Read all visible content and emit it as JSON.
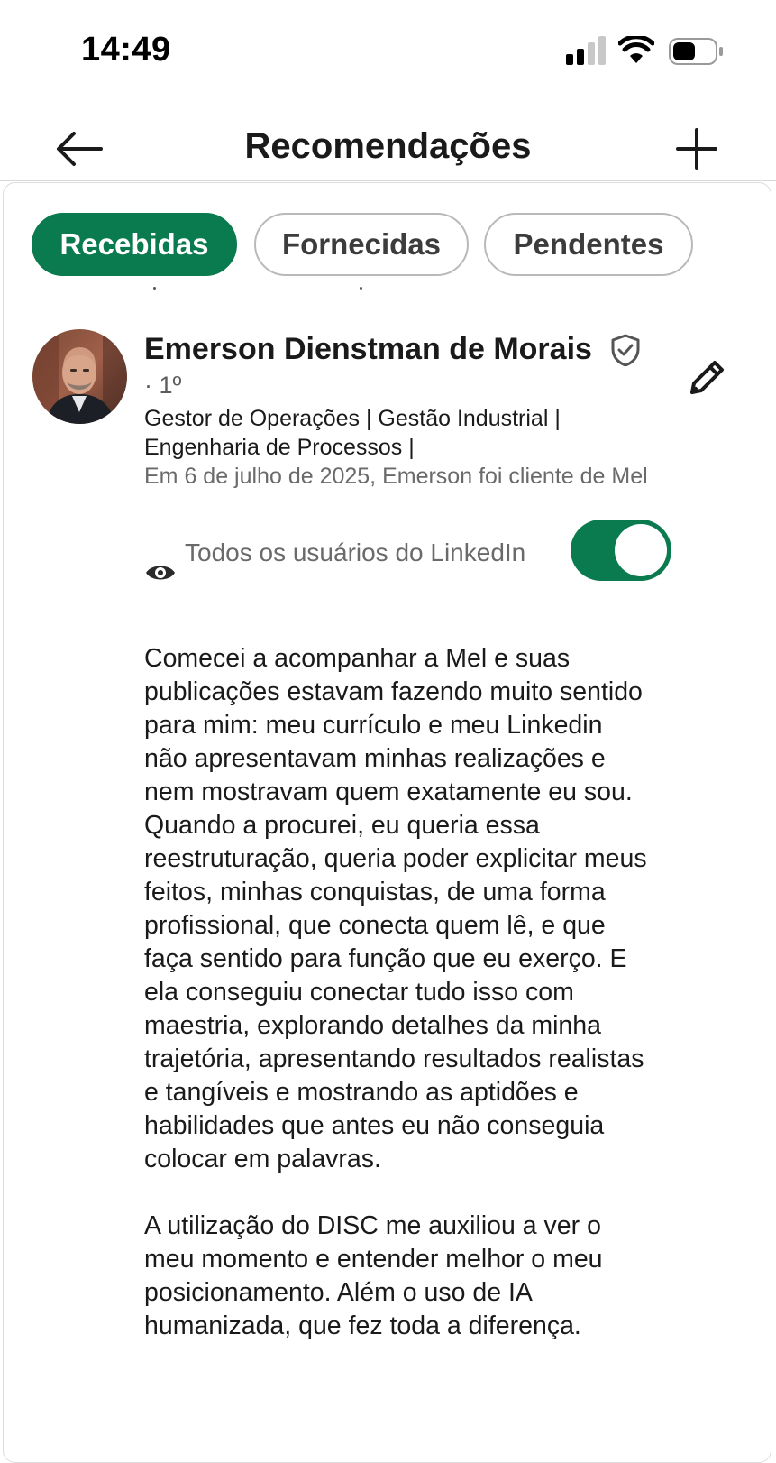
{
  "status_bar": {
    "time": "14:49",
    "icons": [
      "signal-icon",
      "wifi-icon",
      "battery-icon"
    ]
  },
  "nav": {
    "title": "Recomendações",
    "back_icon": "arrow-left-icon",
    "add_icon": "plus-icon"
  },
  "tabs": [
    {
      "label": "Recebidas",
      "active": true
    },
    {
      "label": "Fornecidas",
      "active": false
    },
    {
      "label": "Pendentes",
      "active": false
    }
  ],
  "recommendation": {
    "name": "Emerson Dienstman de Morais",
    "verified_icon": "verified-shield-icon",
    "degree": "· 1º",
    "headline_line1": "Gestor de Operações | Gestão Industrial |",
    "headline_line2": "Engenharia de Processos |",
    "relation": "Em 6 de julho de 2025, Emerson foi cliente de Mel",
    "visibility": "Todos os usuários do LinkedIn",
    "visibility_enabled": true,
    "edit_icon": "pencil-icon",
    "paragraph1": "Comecei a acompanhar a Mel e suas publicações estavam fazendo muito sentido para mim: meu currículo e meu Linkedin não apresentavam minhas realizações e nem mostravam quem exatamente eu sou. Quando a procurei, eu queria essa reestruturação, queria poder explicitar meus feitos, minhas conquistas, de uma forma profissional, que conecta quem lê, e que faça sentido para função que eu exerço. E ela conseguiu conectar tudo isso com maestria, explorando detalhes da minha trajetória, apresentando resultados realistas e tangíveis e mostrando as aptidões e habilidades que antes eu não conseguia colocar em palavras.",
    "paragraph2": "A utilização do DISC me auxiliou a ver o meu momento e entender melhor o meu posicionamento. Além o uso de IA humanizada, que fez toda a diferença."
  },
  "colors": {
    "accent": "#0a7a4f",
    "muted_text": "#6a6a6a",
    "border": "#b9b9b9"
  }
}
